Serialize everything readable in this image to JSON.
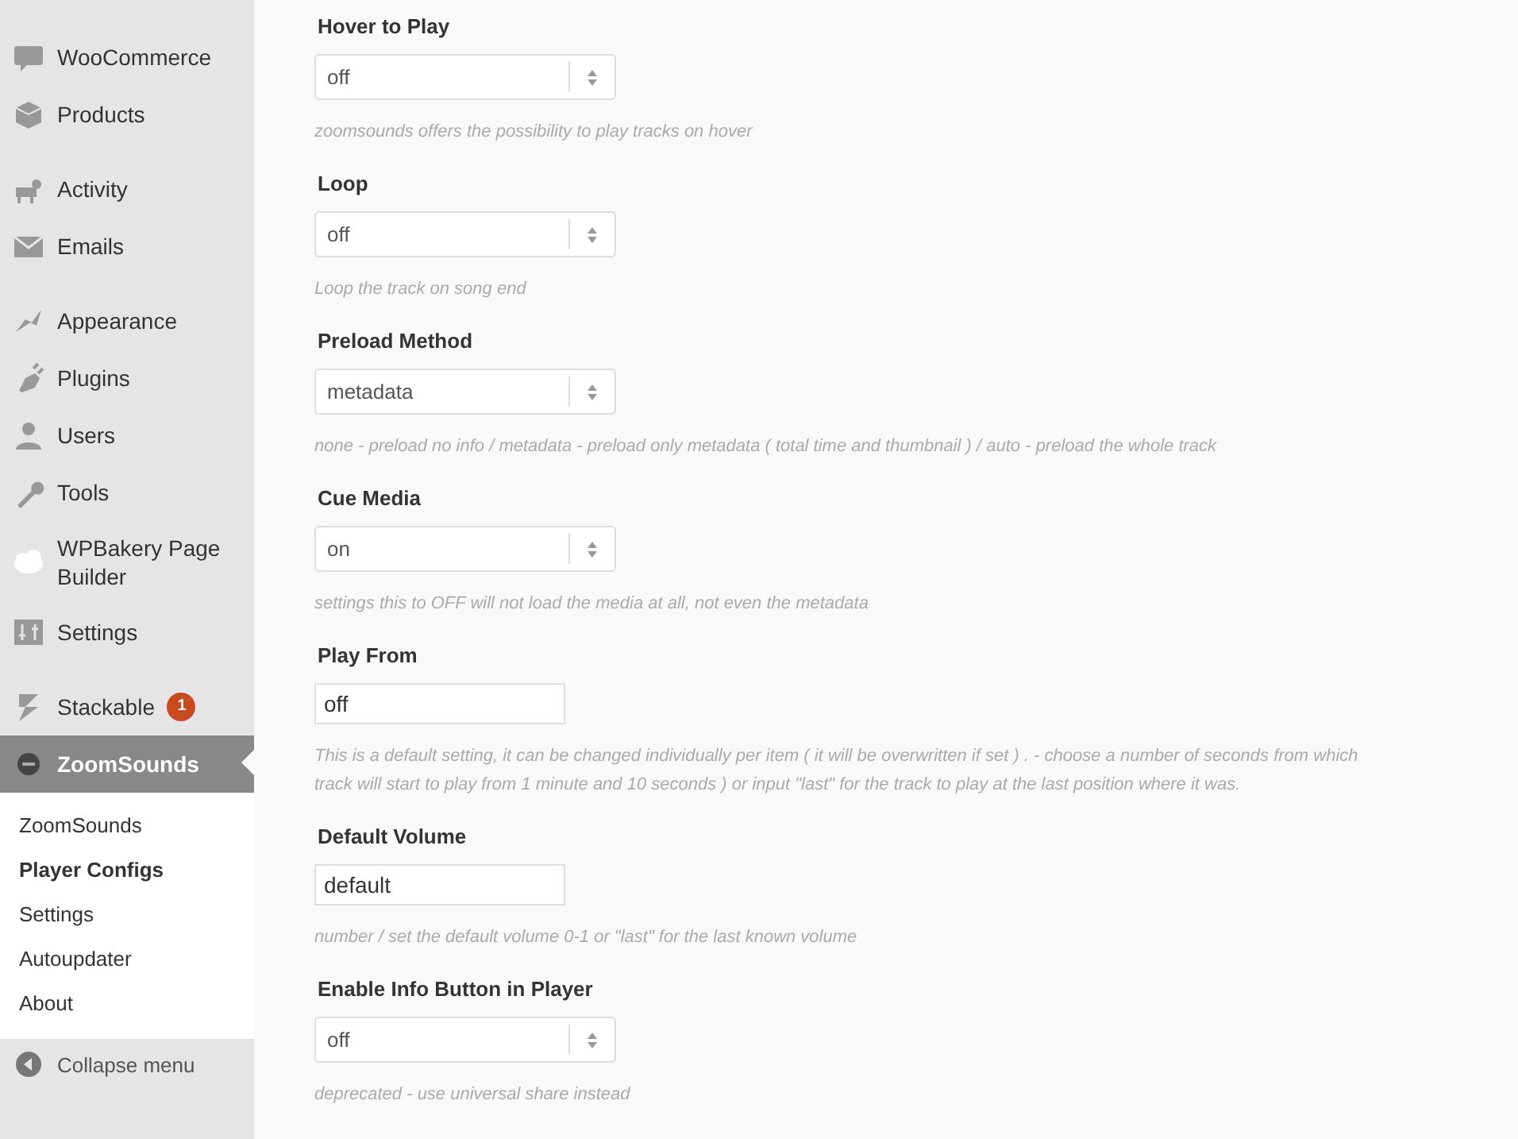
{
  "sidebar": {
    "groups": [
      [
        {
          "label": "WooCommerce"
        },
        {
          "label": "Products"
        }
      ],
      [
        {
          "label": "Activity"
        },
        {
          "label": "Emails"
        }
      ],
      [
        {
          "label": "Appearance"
        },
        {
          "label": "Plugins"
        },
        {
          "label": "Users"
        },
        {
          "label": "Tools"
        },
        {
          "label": "WPBakery Page Builder"
        },
        {
          "label": "Settings"
        }
      ],
      [
        {
          "label": "Stackable",
          "badge": "1"
        },
        {
          "label": "ZoomSounds",
          "current": true
        }
      ]
    ],
    "submenu": [
      {
        "label": "ZoomSounds",
        "selected": false
      },
      {
        "label": "Player Configs",
        "selected": true
      },
      {
        "label": "Settings",
        "selected": false
      },
      {
        "label": "Autoupdater",
        "selected": false
      },
      {
        "label": "About",
        "selected": false
      }
    ],
    "collapse": "Collapse menu"
  },
  "settings": [
    {
      "label": "Hover to Play",
      "kind": "select",
      "value": "off",
      "help": [
        "zoomsounds offers the possibility to play tracks on hover"
      ]
    },
    {
      "label": "Loop",
      "kind": "select",
      "value": "off",
      "help": [
        "Loop the track on song end"
      ]
    },
    {
      "label": "Preload Method",
      "kind": "select",
      "value": "metadata",
      "help": [
        "none - preload no info / metadata - preload only metadata ( total time and thumbnail ) / auto - preload the whole track"
      ]
    },
    {
      "label": "Cue Media",
      "kind": "select",
      "value": "on",
      "help": [
        "settings this to OFF will not load the media at all, not even the metadata"
      ]
    },
    {
      "label": "Play From",
      "kind": "text",
      "value": "off",
      "help": [
        "This is a default setting, it can be changed individually per item ( it will be overwritten if set ) . - choose a number of seconds from which",
        "track will start to play from 1 minute and 10 seconds ) or input \"last\" for the track to play at the last position where it was."
      ]
    },
    {
      "label": "Default Volume",
      "kind": "text",
      "value": "default",
      "help": [
        "number / set the default volume 0-1 or \"last\" for the last known volume"
      ]
    },
    {
      "label": "Enable Info Button in Player",
      "kind": "select",
      "value": "off",
      "help": [
        "deprecated - use universal share instead"
      ]
    }
  ]
}
